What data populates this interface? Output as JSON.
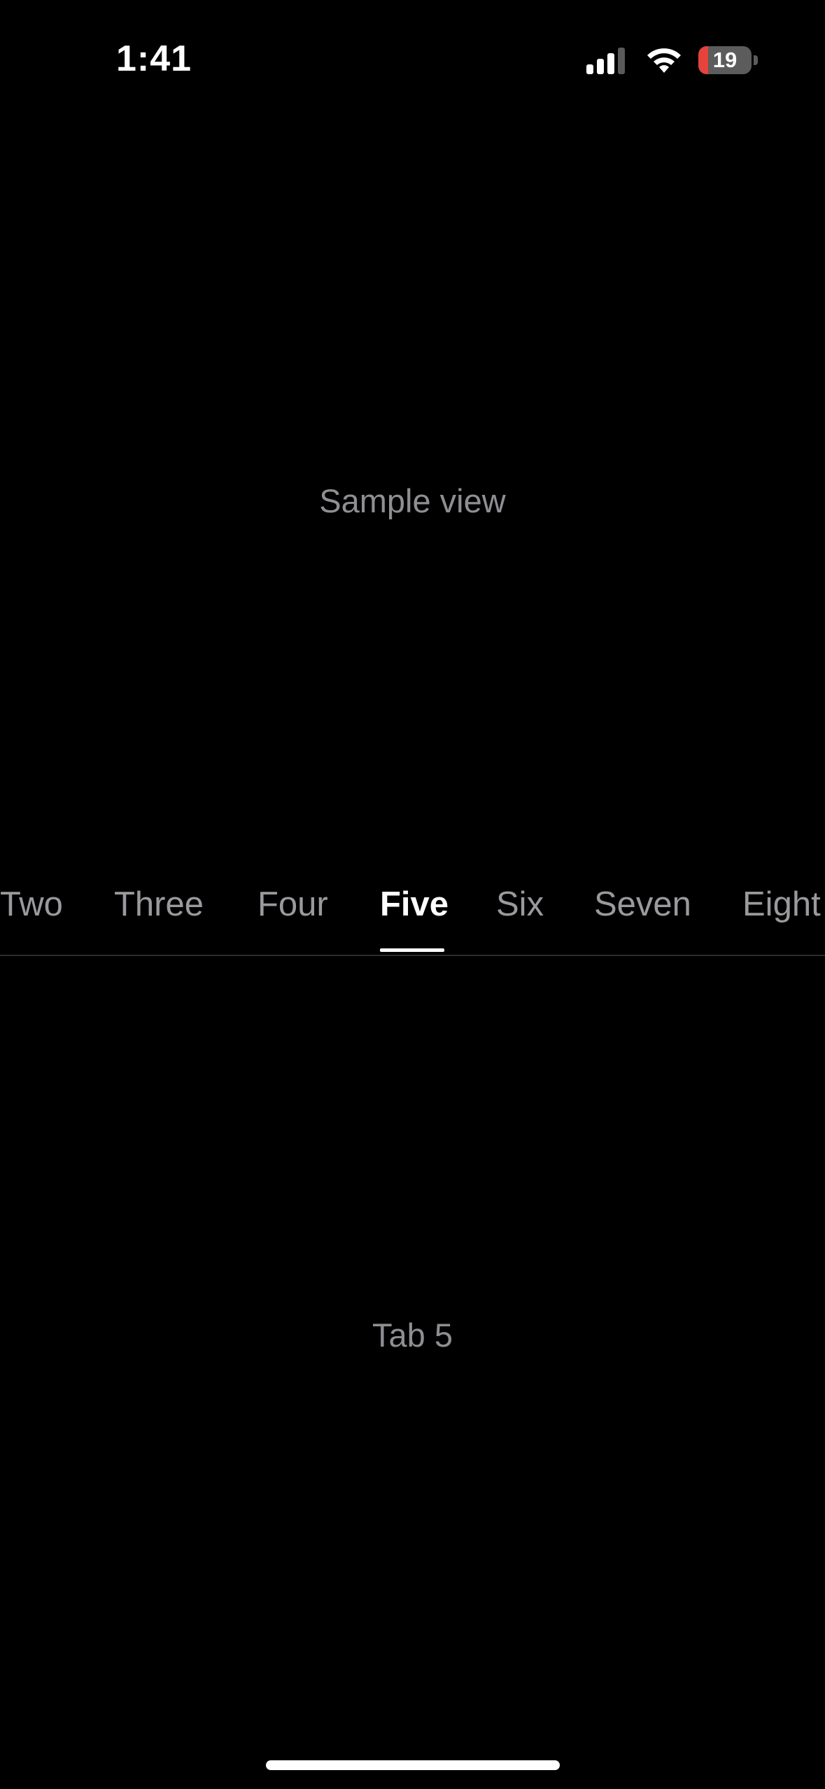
{
  "status_bar": {
    "time": "1:41",
    "battery_level": "19",
    "signal_bars_active": 3,
    "signal_bars_total": 4,
    "battery_fraction": 0.19,
    "battery_color": "#e5433b"
  },
  "sample_view": {
    "label": "Sample view"
  },
  "tabs": {
    "items": [
      "Two",
      "Three",
      "Four",
      "Five",
      "Six",
      "Seven",
      "Eight"
    ],
    "active_index": 3
  },
  "content": {
    "label": "Tab 5"
  },
  "colors": {
    "background": "#000000",
    "muted_text": "#8e8e93",
    "active_tab": "#ffffff",
    "inactive_tab": "#9a9a9e"
  }
}
